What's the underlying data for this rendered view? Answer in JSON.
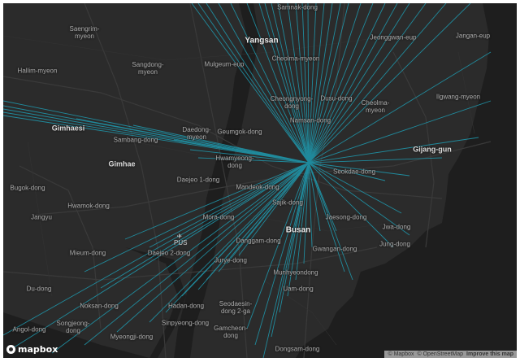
{
  "map": {
    "place_labels": [
      {
        "id": "samnak-dong",
        "text": "Samnak-dong",
        "kind": "area"
      },
      {
        "id": "saengrim-myeon",
        "text": "Saengrim-\nmyeon",
        "kind": "area"
      },
      {
        "id": "yangsan",
        "text": "Yangsan",
        "kind": "city"
      },
      {
        "id": "jeonggwan-eup",
        "text": "Jeonggwan-eup",
        "kind": "area"
      },
      {
        "id": "jangan-eup",
        "text": "Jangan-eup",
        "kind": "area"
      },
      {
        "id": "sangdong-myeon",
        "text": "Sangdong-\nmyeon",
        "kind": "area"
      },
      {
        "id": "mulgeum-eup",
        "text": "Mulgeum-eup",
        "kind": "area"
      },
      {
        "id": "cheolma-myeon",
        "text": "Cheolma-myeon",
        "kind": "area"
      },
      {
        "id": "hallim-myeon",
        "text": "Hallim-myeon",
        "kind": "area"
      },
      {
        "id": "ilgwang-myeon",
        "text": "Ilgwang-myeon",
        "kind": "area"
      },
      {
        "id": "cheongnyongno-dong",
        "text": "Cheongnyong-\ndong",
        "kind": "area"
      },
      {
        "id": "dusu-dong",
        "text": "Dusu-dong",
        "kind": "area"
      },
      {
        "id": "cheolma-myeon-2",
        "text": "Cheolma-\nmyeon",
        "kind": "area"
      },
      {
        "id": "namsan-dong",
        "text": "Namsan-dong",
        "kind": "area"
      },
      {
        "id": "gimhaesi",
        "text": "Gimhaesi",
        "kind": "bold"
      },
      {
        "id": "daedong-myeon",
        "text": "Daedong-\nmyeon",
        "kind": "area"
      },
      {
        "id": "geumgok-dong",
        "text": "Geumgok-dong",
        "kind": "area"
      },
      {
        "id": "sambang-dong",
        "text": "Sambang-dong",
        "kind": "area"
      },
      {
        "id": "gijang-gun",
        "text": "Gijang-gun",
        "kind": "bold"
      },
      {
        "id": "gimhae",
        "text": "Gimhae",
        "kind": "bold"
      },
      {
        "id": "hwamyeong-dong",
        "text": "Hwamyeong-\ndong",
        "kind": "area"
      },
      {
        "id": "seokdae-dong",
        "text": "Seokdae-dong",
        "kind": "area"
      },
      {
        "id": "daejeo1-dong",
        "text": "Daejeo 1-dong",
        "kind": "area"
      },
      {
        "id": "bugok-dong",
        "text": "Bugok-dong",
        "kind": "area"
      },
      {
        "id": "mandeok-dong",
        "text": "Mandeok-dong",
        "kind": "area"
      },
      {
        "id": "sajik-dong",
        "text": "Sajik-dong",
        "kind": "area"
      },
      {
        "id": "hwamok-dong",
        "text": "Hwamok-dong",
        "kind": "area"
      },
      {
        "id": "jangyu",
        "text": "Jangyu",
        "kind": "area"
      },
      {
        "id": "mora-dong",
        "text": "Mora-dong",
        "kind": "area"
      },
      {
        "id": "jaesong-dong",
        "text": "Jaesong-dong",
        "kind": "area"
      },
      {
        "id": "jwa-dong",
        "text": "Jwa-dong",
        "kind": "area"
      },
      {
        "id": "busan",
        "text": "Busan",
        "kind": "city"
      },
      {
        "id": "danggam-dong",
        "text": "Danggam-dong",
        "kind": "area"
      },
      {
        "id": "jung-dong",
        "text": "Jung-dong",
        "kind": "area"
      },
      {
        "id": "gwangan-dong",
        "text": "Gwangan-dong",
        "kind": "area"
      },
      {
        "id": "mieum-dong",
        "text": "Mieum-dong",
        "kind": "area"
      },
      {
        "id": "daejeo2-dong",
        "text": "Daejeo 2-dong",
        "kind": "area"
      },
      {
        "id": "jurye-dong",
        "text": "Jurye-dong",
        "kind": "area"
      },
      {
        "id": "munhyeon-dong",
        "text": "Munhyeondong",
        "kind": "area"
      },
      {
        "id": "du-dong",
        "text": "Du-dong",
        "kind": "area"
      },
      {
        "id": "uam-dong",
        "text": "Uam-dong",
        "kind": "area"
      },
      {
        "id": "noksan-dong",
        "text": "Noksan-dong",
        "kind": "area"
      },
      {
        "id": "hadan-dong",
        "text": "Hadan-dong",
        "kind": "area"
      },
      {
        "id": "seodaesin-dong-2-ga",
        "text": "Seodaesin-\ndong 2-ga",
        "kind": "area"
      },
      {
        "id": "songjeong-dong",
        "text": "Songjeong-\ndong",
        "kind": "area"
      },
      {
        "id": "sinpyeong-dong",
        "text": "Sinpyeong-dong",
        "kind": "area"
      },
      {
        "id": "angol-dong",
        "text": "Angol-dong",
        "kind": "area"
      },
      {
        "id": "gamcheon-dong",
        "text": "Gamcheon-\ndong",
        "kind": "area"
      },
      {
        "id": "myeongji-dong",
        "text": "Myeongji-dong",
        "kind": "area"
      },
      {
        "id": "dongsam-dong",
        "text": "Dongsam-dong",
        "kind": "area"
      }
    ],
    "airport": {
      "code": "PUS",
      "icon": "airplane-icon"
    },
    "flow_lines": {
      "color": "#1f9bb0",
      "hub": "Namsan-dong"
    },
    "logo": {
      "text": "mapbox",
      "icon": "mapbox-logo-icon"
    },
    "attribution": {
      "mapbox": "© Mapbox",
      "osm": "© OpenStreetMap",
      "improve": "Improve this map"
    }
  }
}
